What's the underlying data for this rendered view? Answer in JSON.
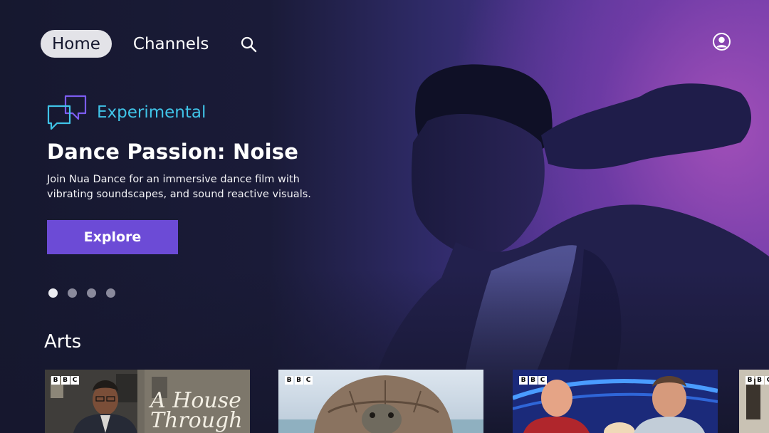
{
  "nav": {
    "items": [
      {
        "label": "Home",
        "active": true
      },
      {
        "label": "Channels",
        "active": false
      }
    ],
    "search_icon": "search-icon",
    "account_icon": "account-icon"
  },
  "hero": {
    "genre": {
      "label": "Experimental",
      "icon": "speech-bubbles-icon",
      "color": "#40c4e8"
    },
    "title": "Dance Passion: Noise",
    "description": "Join Nua Dance for an immersive dance film with vibrating soundscapes, and sound reactive visuals.",
    "cta_label": "Explore",
    "cta_color": "#6c4bd6",
    "carousel": {
      "total": 4,
      "active": 1
    }
  },
  "rows": [
    {
      "title": "Arts",
      "cards": [
        {
          "brand": [
            "B",
            "B",
            "C"
          ],
          "title_text": "A House Through"
        },
        {
          "brand": [
            "B",
            "B",
            "C"
          ]
        },
        {
          "brand": [
            "B",
            "B",
            "C"
          ]
        },
        {
          "brand": [
            "B",
            "B",
            "C"
          ]
        }
      ]
    }
  ]
}
